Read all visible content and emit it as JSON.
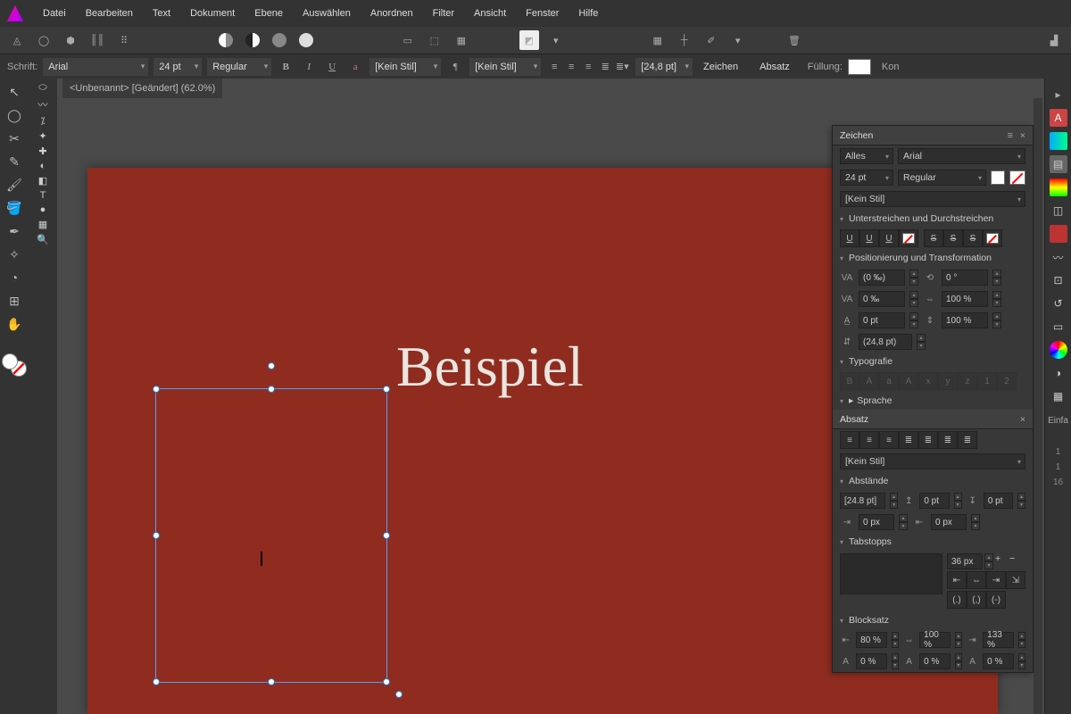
{
  "menu": [
    "Datei",
    "Bearbeiten",
    "Text",
    "Dokument",
    "Ebene",
    "Auswählen",
    "Anordnen",
    "Filter",
    "Ansicht",
    "Fenster",
    "Hilfe"
  ],
  "tab": {
    "title": "<Unbenannt> [Geändert] (62.0%)"
  },
  "context": {
    "font_label": "Schrift:",
    "font": "Arial",
    "size": "24 pt",
    "weight": "Regular",
    "charstyle": "[Kein Stil]",
    "parastyle": "[Kein Stil]",
    "leading": "[24,8 pt]",
    "zeichen": "Zeichen",
    "absatz": "Absatz",
    "fill_label": "Füllung:",
    "kontur": "Kon"
  },
  "canvas": {
    "text": "Beispiel"
  },
  "panel_zeichen": {
    "title": "Zeichen",
    "category": "Alles",
    "font": "Arial",
    "size": "24 pt",
    "weight": "Regular",
    "style": "[Kein Stil]",
    "sec_underline": "Unterstreichen und Durchstreichen",
    "sec_pos": "Positionierung und Transformation",
    "kerning": "(0 ‰)",
    "tracking": "0 ‰",
    "baseline": "0 pt",
    "leading": "(24,8 pt)",
    "rotate": "0 °",
    "scale_h": "100 %",
    "scale_v": "100 %",
    "sec_typo": "Typografie",
    "sec_lang": "Sprache"
  },
  "panel_absatz": {
    "title": "Absatz",
    "style": "[Kein Stil]",
    "sec_spacing": "Abstände",
    "lead": "[24.8 pt]",
    "sp1": "0 pt",
    "sp2": "0 pt",
    "indent1": "0 px",
    "indent2": "0 px",
    "sec_tabs": "Tabstopps",
    "tabval": "36 px",
    "sec_block": "Blocksatz",
    "bs1": "80 %",
    "bs2": "100 %",
    "bs3": "133 %",
    "bs4": "0 %",
    "bs5": "0 %",
    "bs6": "0 %"
  },
  "right_labels": {
    "einfa": "Einfa"
  }
}
